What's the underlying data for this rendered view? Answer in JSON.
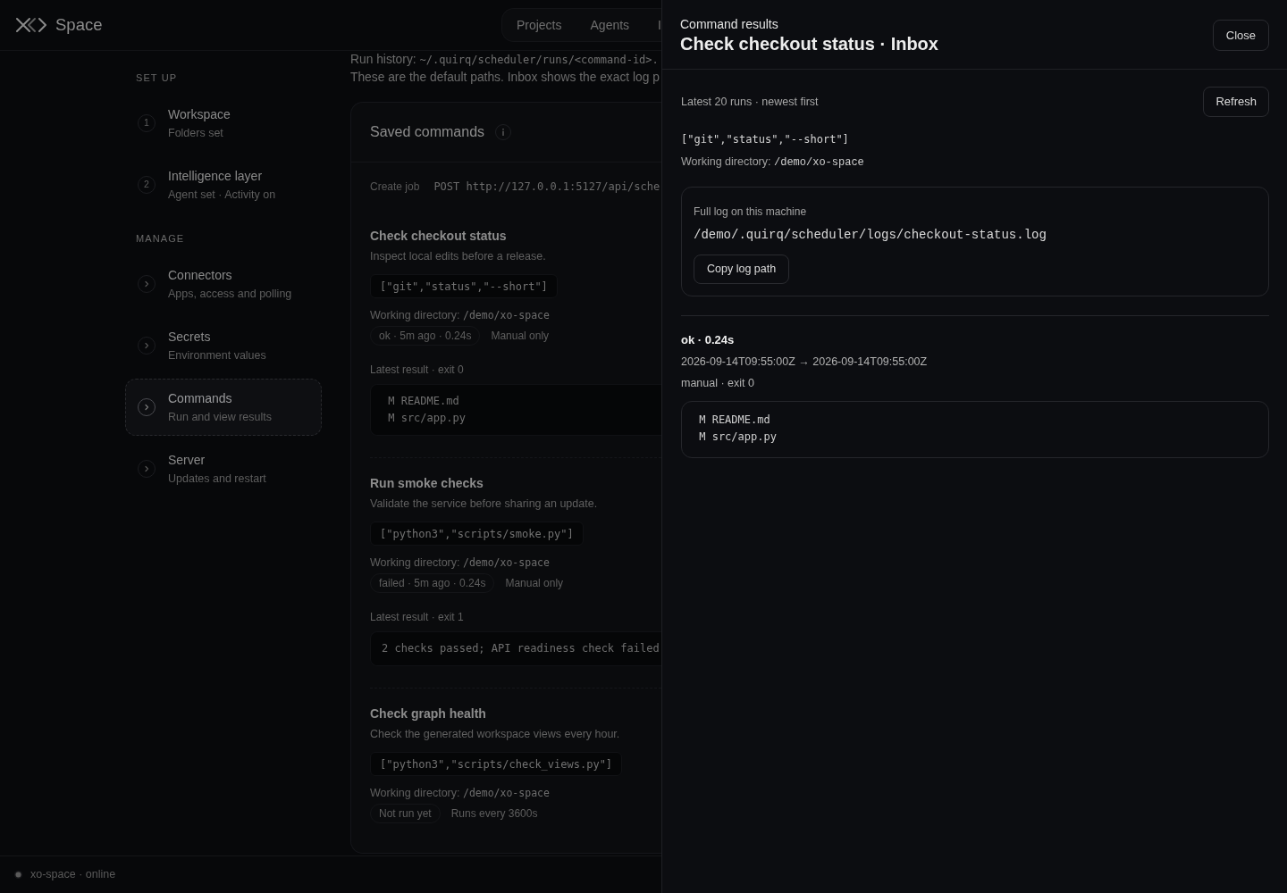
{
  "header": {
    "app_name": "Space",
    "tabs": [
      {
        "label": "Projects",
        "selected": false
      },
      {
        "label": "Agents",
        "selected": false
      },
      {
        "label": "I",
        "selected": false
      }
    ]
  },
  "sidebar": {
    "sections": [
      {
        "title": "SET UP",
        "items": [
          {
            "number": "1",
            "title": "Workspace",
            "subtitle": "Folders set",
            "selected": false
          },
          {
            "number": "2",
            "title": "Intelligence layer",
            "subtitle": "Agent set · Activity on",
            "selected": false
          }
        ]
      },
      {
        "title": "MANAGE",
        "items": [
          {
            "title": "Connectors",
            "subtitle": "Apps, access and polling",
            "selected": false
          },
          {
            "title": "Secrets",
            "subtitle": "Environment values",
            "selected": false
          },
          {
            "title": "Commands",
            "subtitle": "Run and view results",
            "selected": true
          },
          {
            "title": "Server",
            "subtitle": "Updates and restart",
            "selected": false
          }
        ]
      }
    ]
  },
  "main": {
    "run_history": {
      "label": "Run history:",
      "path": "~/.quirq/scheduler/runs/<command-id>."
    },
    "note": "These are the default paths. Inbox shows the exact log p",
    "saved_commands": {
      "title": "Saved commands",
      "create_job": {
        "label": "Create job",
        "endpoint": "POST http://127.0.0.1:5127/api/sche"
      },
      "commands": [
        {
          "name": "Check checkout status",
          "description": "Inspect local edits before a release.",
          "argv": "[\"git\",\"status\",\"--short\"]",
          "working_directory": {
            "label": "Working directory:",
            "path": "/demo/xo-space"
          },
          "status": "ok · 5m ago · 0.24s",
          "schedule": "Manual only",
          "result": {
            "label": "Latest result · exit 0",
            "lines": [
              " M README.md",
              " M src/app.py"
            ]
          }
        },
        {
          "name": "Run smoke checks",
          "description": "Validate the service before sharing an update.",
          "argv": "[\"python3\",\"scripts/smoke.py\"]",
          "working_directory": {
            "label": "Working directory:",
            "path": "/demo/xo-space"
          },
          "status": "failed · 5m ago · 0.24s",
          "schedule": "Manual only",
          "result": {
            "label": "Latest result · exit 1",
            "lines": [
              "2 checks passed; API readiness check failed"
            ]
          }
        },
        {
          "name": "Check graph health",
          "description": "Check the generated workspace views every hour.",
          "argv": "[\"python3\",\"scripts/check_views.py\"]",
          "working_directory": {
            "label": "Working directory:",
            "path": "/demo/xo-space"
          },
          "status": "Not run yet",
          "schedule": "Runs every 3600s"
        }
      ]
    }
  },
  "status_bar": {
    "text": "xo-space · online"
  },
  "drawer": {
    "eyebrow": "Command results",
    "title": "Check checkout status · Inbox",
    "close_label": "Close",
    "summary": "Latest 20 runs · newest first",
    "refresh_label": "Refresh",
    "argv": "[\"git\",\"status\",\"--short\"]",
    "working_directory": {
      "label": "Working directory:",
      "path": "/demo/xo-space"
    },
    "log": {
      "label": "Full log on this machine",
      "path": "/demo/.quirq/scheduler/logs/checkout-status.log",
      "copy_label": "Copy log path"
    },
    "runs": [
      {
        "status": "ok · 0.24s",
        "time_range": "2026-09-14T09:55:00Z → 2026-09-14T09:55:00Z",
        "detail": "manual · exit 0",
        "lines": [
          " M README.md",
          " M src/app.py"
        ]
      }
    ]
  }
}
